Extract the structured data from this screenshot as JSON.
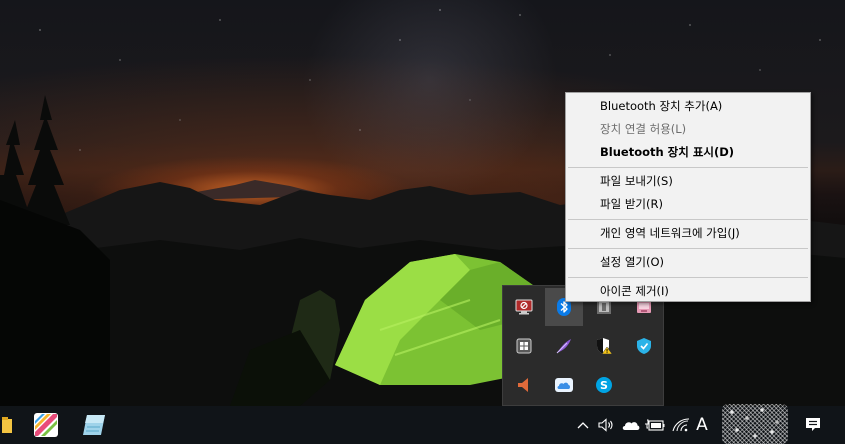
{
  "context_menu": {
    "items": [
      {
        "label": "Bluetooth 장치 추가(A)"
      },
      {
        "label": "장치 연결 허용(L)"
      },
      {
        "label": "Bluetooth 장치 표시(D)"
      },
      {
        "label": "파일 보내기(S)"
      },
      {
        "label": "파일 받기(R)"
      },
      {
        "label": "개인 영역 네트워크에 가입(J)"
      },
      {
        "label": "설정 열기(O)"
      },
      {
        "label": "아이콘 제거(I)"
      }
    ]
  },
  "tray_flyout": {
    "icons": [
      "remote-display-icon",
      "bluetooth-icon",
      "device-icon",
      "pink-app-icon",
      "window-manager-icon",
      "feather-app-icon",
      "security-shield-warning-icon",
      "shield-app-icon",
      "speaker-app-icon",
      "icloud-icon",
      "skype-icon"
    ]
  },
  "taskbar": {
    "ime_label": "A",
    "apps": [
      "file-explorer-icon",
      "color-app-icon",
      "notepad-app-icon"
    ],
    "system_icons": [
      "chevron-up-icon",
      "volume-icon",
      "onedrive-cloud-icon",
      "battery-icon",
      "wifi-icon",
      "ime-indicator",
      "notification-icon"
    ]
  },
  "colors": {
    "menu_bg": "#f2f2f2",
    "flyout_bg": "#2b2b2b",
    "taskbar_bg": "#101418",
    "bluetooth_blue": "#0a7be8",
    "tent_green": "#8ed13a"
  }
}
